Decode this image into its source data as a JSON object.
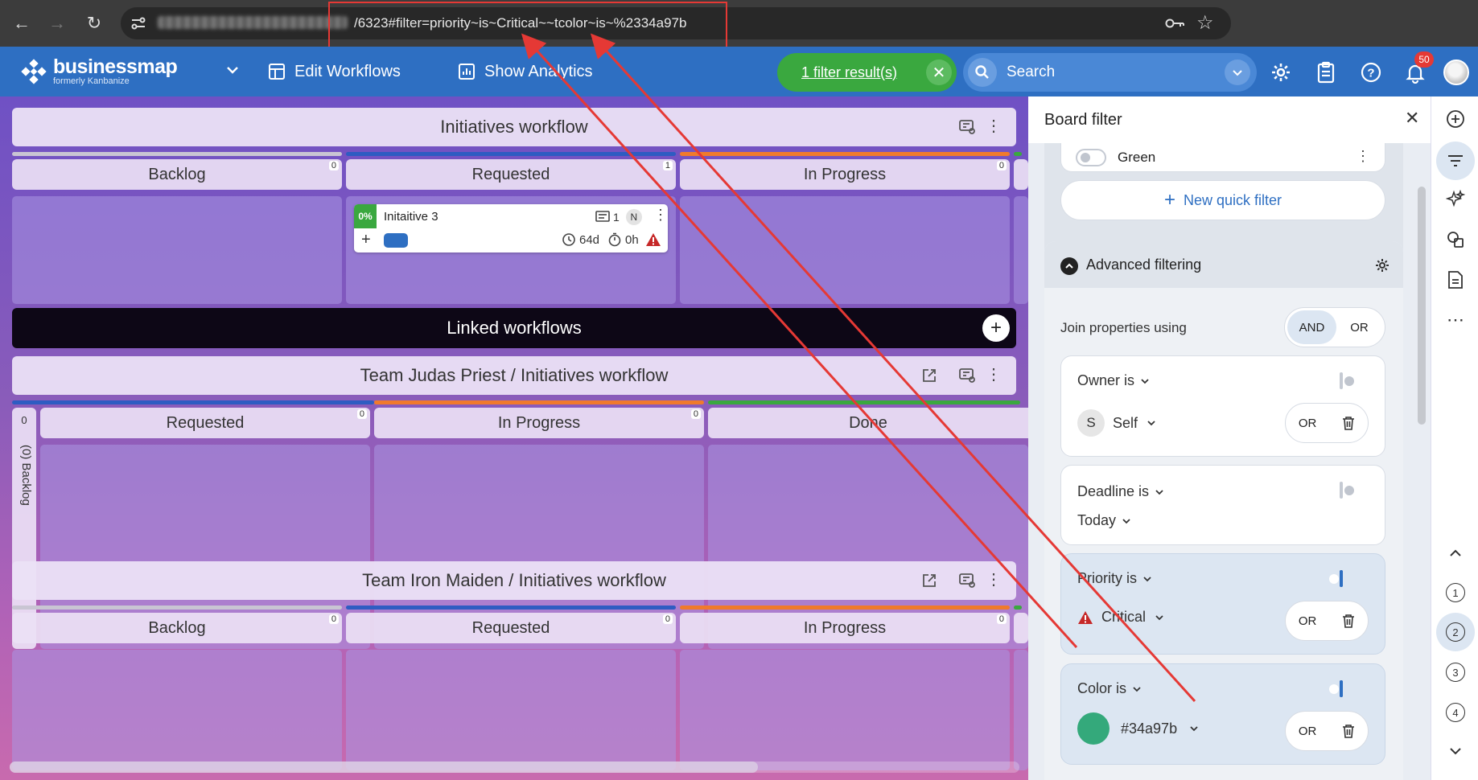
{
  "browser": {
    "url": "/6323#filter=priority~is~Critical~~tcolor~is~%2334a97b"
  },
  "header": {
    "brand": "businessmap",
    "brand_sub": "formerly Kanbanize",
    "edit_workflows": "Edit Workflows",
    "show_analytics": "Show Analytics",
    "filter_result": "1 filter result(s)",
    "search_placeholder": "Search",
    "notification_count": "50"
  },
  "board": {
    "initiatives": {
      "title": "Initiatives workflow",
      "columns": [
        {
          "name": "Backlog",
          "count": "0"
        },
        {
          "name": "Requested",
          "count": "1"
        },
        {
          "name": "In Progress",
          "count": "0"
        }
      ],
      "card": {
        "progress": "0%",
        "title": "Initaitive 3",
        "count": "1",
        "owner_initial": "N",
        "age": "64d",
        "time": "0h"
      }
    },
    "linked_title": "Linked workflows",
    "judas": {
      "title": "Team Judas Priest / Initiatives workflow",
      "backlog_collapsed": "(0) Backlog",
      "backlog_count": "0",
      "columns": [
        {
          "name": "Requested",
          "count": "0"
        },
        {
          "name": "In Progress",
          "count": "0"
        },
        {
          "name": "Done",
          "count": ""
        }
      ]
    },
    "iron": {
      "title": "Team Iron Maiden / Initiatives workflow",
      "columns": [
        {
          "name": "Backlog",
          "count": "0"
        },
        {
          "name": "Requested",
          "count": "0"
        },
        {
          "name": "In Progress",
          "count": "0"
        }
      ]
    }
  },
  "panel": {
    "title": "Board filter",
    "quick_filter_green": "Green",
    "new_quick_filter": "New quick filter",
    "advanced_title": "Advanced filtering",
    "join_label": "Join properties using",
    "join_and": "AND",
    "join_or": "OR",
    "owner": {
      "label": "Owner is",
      "avatar": "S",
      "value": "Self",
      "or": "OR"
    },
    "deadline": {
      "label": "Deadline is",
      "value": "Today"
    },
    "priority": {
      "label": "Priority is",
      "value": "Critical",
      "or": "OR"
    },
    "color": {
      "label": "Color is",
      "value": "#34a97b",
      "swatch": "#34a97b",
      "or": "OR"
    }
  },
  "rail": {
    "steps": [
      "1",
      "2",
      "3",
      "4"
    ]
  },
  "colors": {
    "brand_blue": "#2e6fc2",
    "filter_green": "#3aa83f",
    "annotation_red": "#e53935",
    "critical_red": "#d32f2f",
    "card_color": "#34a97b"
  }
}
